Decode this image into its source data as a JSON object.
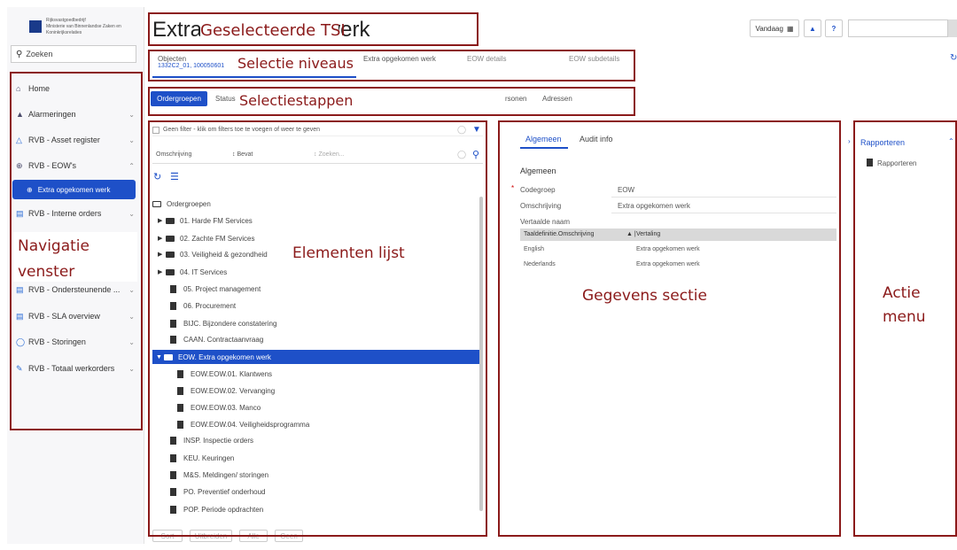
{
  "logo": {
    "line1": "Rijksvastgoedbedrijf",
    "line2": "Ministerie van Binnenlandse Zaken en",
    "line3": "Koninkrijksrelaties"
  },
  "page_title": "Extra opgekomen werk",
  "search": {
    "placeholder": "Zoeken"
  },
  "header": {
    "today_label": "Vandaag",
    "help": "?"
  },
  "nav": [
    {
      "label": "Home"
    },
    {
      "label": "Alarmeringen"
    },
    {
      "label": "RVB - Asset register"
    },
    {
      "label": "RVB - EOW's"
    },
    {
      "label": "Extra opgekomen werk"
    },
    {
      "label": "RVB - Interne orders"
    },
    {
      "label": "RVB - Ondersteunende ..."
    },
    {
      "label": "RVB - SLA overview"
    },
    {
      "label": "RVB - Storingen"
    },
    {
      "label": "RVB - Totaal werkorders"
    }
  ],
  "levels": {
    "objecten_label": "Objecten",
    "objecten_value": "1332C2_01, 100050601",
    "extra_label": "Extra opgekomen werk",
    "details": "EOW details",
    "subdetails": "EOW subdetails"
  },
  "steps": {
    "active": "Ordergroepen",
    "status": "Status",
    "personen": "rsonen",
    "adressen": "Adressen"
  },
  "filter": {
    "text": "Geen filter - klik om filters toe te voegen of weer te geven",
    "field": "Omschrijving",
    "operator": "Bevat",
    "placeholder": "Zoeken..."
  },
  "tree": [
    {
      "label": "Ordergroepen"
    },
    {
      "label": "01. Harde FM Services"
    },
    {
      "label": "02. Zachte FM Services"
    },
    {
      "label": "03. Veiligheid & gezondheid"
    },
    {
      "label": "04. IT Services"
    },
    {
      "label": "05. Project management"
    },
    {
      "label": "06. Procurement"
    },
    {
      "label": "BIJC. Bijzondere constatering"
    },
    {
      "label": "CAAN. Contractaanvraag"
    },
    {
      "label": "EOW. Extra opgekomen werk"
    },
    {
      "label": "EOW.EOW.01. Klantwens"
    },
    {
      "label": "EOW.EOW.02. Vervanging"
    },
    {
      "label": "EOW.EOW.03. Manco"
    },
    {
      "label": "EOW.EOW.04. Veiligheidsprogramma"
    },
    {
      "label": "INSP. Inspectie orders"
    },
    {
      "label": "KEU. Keuringen"
    },
    {
      "label": "M&S. Meldingen/ storingen"
    },
    {
      "label": "PO. Preventief onderhoud"
    },
    {
      "label": "POP. Periode opdrachten"
    }
  ],
  "bottom_buttons": [
    "Sort",
    "Uitbreiden",
    "Alle",
    "Geen"
  ],
  "details": {
    "tab_general": "Algemeen",
    "tab_audit": "Audit info",
    "section": "Algemeen",
    "codegroep_label": "Codegroep",
    "codegroep_value": "EOW",
    "omschrijving_label": "Omschrijving",
    "omschrijving_value": "Extra opgekomen werk",
    "vertaalde_label": "Vertaalde naam",
    "table_headers": [
      "Taaldefinitie.Omschrijving",
      "Vertaling"
    ],
    "rows": [
      {
        "lang": "English",
        "value": "Extra opgekomen werk"
      },
      {
        "lang": "Nederlands",
        "value": "Extra opgekomen werk"
      }
    ]
  },
  "actions": {
    "header": "Rapporteren",
    "item": "Rapporteren"
  },
  "annotations": {
    "title_overlay": "Geselecteerde TSI",
    "levels": "Selectie niveaus",
    "steps": "Selectiestappen",
    "nav_line1": "Navigatie",
    "nav_line2": "venster",
    "list": "Elementen lijst",
    "data": "Gegevens sectie",
    "action_line1": "Actie",
    "action_line2": "menu"
  },
  "colors": {
    "accent": "#1e50c8",
    "annotation": "#8b1a1a"
  }
}
